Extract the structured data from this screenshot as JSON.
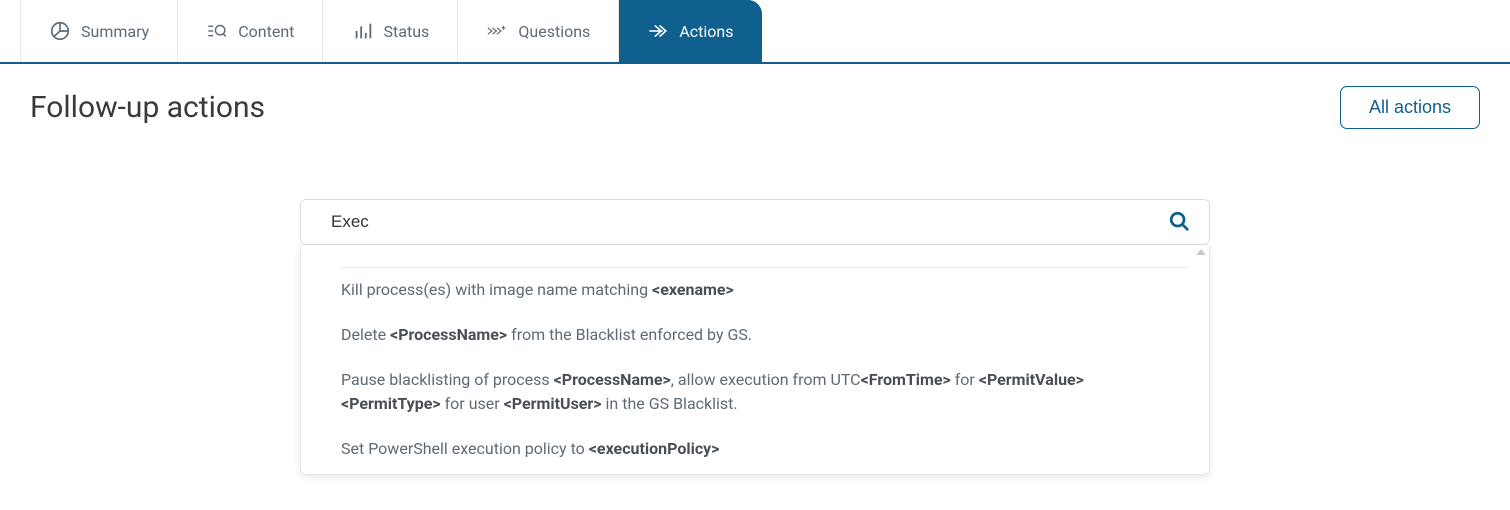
{
  "tabs": [
    {
      "id": "summary",
      "label": "Summary",
      "icon": "pie-chart-icon",
      "active": false
    },
    {
      "id": "content",
      "label": "Content",
      "icon": "search-list-icon",
      "active": false
    },
    {
      "id": "status",
      "label": "Status",
      "icon": "bar-chart-icon",
      "active": false
    },
    {
      "id": "questions",
      "label": "Questions",
      "icon": "fast-forward-plus-icon",
      "active": false
    },
    {
      "id": "actions",
      "label": "Actions",
      "icon": "arrow-right-icon",
      "active": true
    }
  ],
  "page": {
    "title": "Follow-up actions",
    "all_actions_label": "All actions"
  },
  "search": {
    "value": "Exec",
    "placeholder": ""
  },
  "results": [
    {
      "segments": [
        {
          "t": "Kill process(es) with image name matching "
        },
        {
          "t": "<exename>",
          "ph": true
        }
      ]
    },
    {
      "segments": [
        {
          "t": "Delete "
        },
        {
          "t": "<ProcessName>",
          "ph": true
        },
        {
          "t": " from the Blacklist enforced by GS."
        }
      ]
    },
    {
      "segments": [
        {
          "t": "Pause blacklisting of process "
        },
        {
          "t": "<ProcessName>",
          "ph": true
        },
        {
          "t": ", allow execution from UTC"
        },
        {
          "t": "<FromTime>",
          "ph": true
        },
        {
          "t": " for "
        },
        {
          "t": "<PermitValue>",
          "ph": true
        },
        {
          "t": " "
        },
        {
          "t": "<PermitType>",
          "ph": true
        },
        {
          "t": " for user "
        },
        {
          "t": "<PermitUser>",
          "ph": true
        },
        {
          "t": " in the GS Blacklist."
        }
      ]
    },
    {
      "segments": [
        {
          "t": "Set PowerShell execution policy to "
        },
        {
          "t": "<executionPolicy>",
          "ph": true
        }
      ]
    }
  ],
  "colors": {
    "primary": "#0f5f8f",
    "text_muted": "#5e6a75"
  }
}
